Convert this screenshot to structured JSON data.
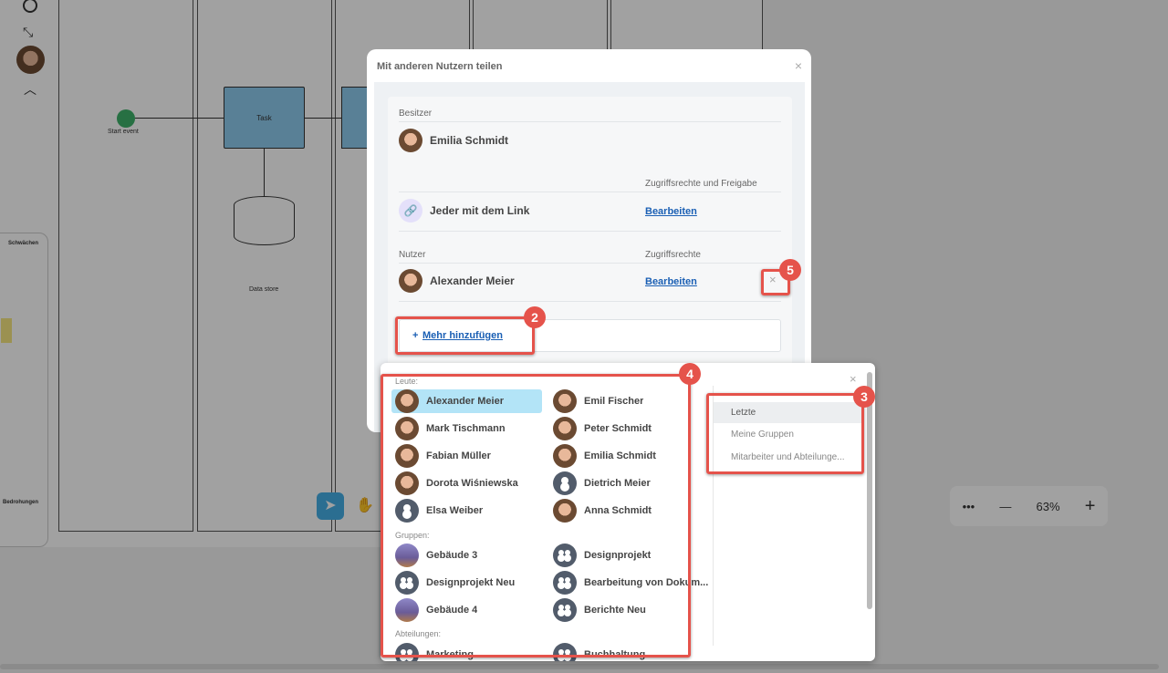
{
  "canvas": {
    "start_event": "Start event",
    "task": "Task",
    "data_store": "Data store",
    "swot_weak": "Schwächen",
    "swot_threat": "Bedrohungen"
  },
  "zoom": {
    "more": "•••",
    "minus": "—",
    "value": "63%",
    "plus": "+"
  },
  "dialog": {
    "title": "Mit anderen Nutzern teilen",
    "close": "×",
    "owner_label": "Besitzer",
    "owner_name": "Emilia Schmidt",
    "rights_share_label": "Zugriffsrechte und Freigabe",
    "link_label": "Jeder mit dem Link",
    "edit": "Bearbeiten",
    "users_label": "Nutzer",
    "rights_label": "Zugriffsrechte",
    "user_name": "Alexander Meier",
    "remove": "×",
    "add_more": "Mehr hinzufügen",
    "plus": "+"
  },
  "picker": {
    "close": "×",
    "people_label": "Leute:",
    "people": [
      "Alexander Meier",
      "Emil Fischer",
      "Mark Tischmann",
      "Peter Schmidt",
      "Fabian Müller",
      "Emilia Schmidt",
      "Dorota Wiśniewska",
      "Dietrich Meier",
      "Elsa Weiber",
      "Anna Schmidt"
    ],
    "groups_label": "Gruppen:",
    "groups": [
      "Gebäude 3",
      "Designprojekt",
      "Designprojekt Neu",
      "Bearbeitung von Dokum...",
      "Gebäude 4",
      "Berichte Neu"
    ],
    "departments_label": "Abteilungen:",
    "departments": [
      "Marketing",
      "Buchhaltung"
    ],
    "tabs": [
      "Letzte",
      "Meine Gruppen",
      "Mitarbeiter und Abteilunge..."
    ]
  },
  "badges": [
    "2",
    "3",
    "4",
    "5"
  ]
}
